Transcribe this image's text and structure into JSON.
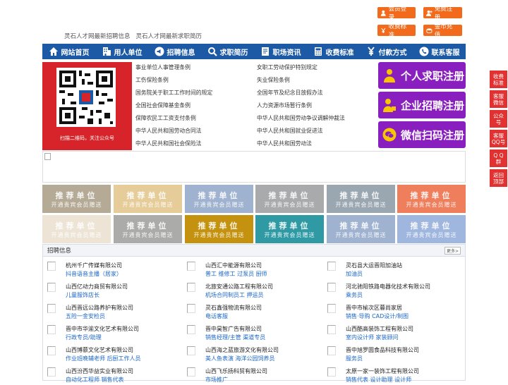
{
  "top_buttons": {
    "login": "会员登录",
    "register": "免费注册",
    "fees": "收费标准",
    "recharge": "金币充值"
  },
  "links": [
    "灵石人才网最新招聘信息",
    "灵石人才网最新求职简历"
  ],
  "nav": [
    {
      "label": "网站首页",
      "icon": "home-icon"
    },
    {
      "label": "用人单位",
      "icon": "building-icon"
    },
    {
      "label": "招聘信息",
      "icon": "megaphone-icon"
    },
    {
      "label": "求职简历",
      "icon": "search-icon"
    },
    {
      "label": "职场资讯",
      "icon": "document-icon"
    },
    {
      "label": "收费标准",
      "icon": "calculator-icon"
    },
    {
      "label": "付款方式",
      "icon": "yen-icon"
    },
    {
      "label": "联系客服",
      "icon": "phone-icon"
    }
  ],
  "qr_caption": "扫描二维码，关注公众号",
  "regulations": [
    [
      "事业单位人事管理条例",
      "女职工劳动保护特别规定"
    ],
    [
      "工伤保险条例",
      "失业保险条例"
    ],
    [
      "国务院关于职工工作时间的规定",
      "全国年节及纪念日放假办法"
    ],
    [
      "全国社会保障基金条例",
      "人力资源市场暂行条例"
    ],
    [
      "保障农民工工资支付条例",
      "中华人民共和国劳动争议调解仲裁法"
    ],
    [
      "中华人民共和国劳动合同法",
      "中华人民共和国就业促进法"
    ],
    [
      "中华人民共和国社会保险法",
      "中华人民共和国劳动法"
    ]
  ],
  "register_buttons": {
    "job_seeker": "个人求职注册",
    "company": "企业招聘注册",
    "wechat": "微信扫码注册"
  },
  "promo": {
    "line1": "推荐单位",
    "line2": "开通贵宾会员赠送",
    "colors": [
      "#b4aa95",
      "#e6cc98",
      "#9fb2cf",
      "#a9aaab",
      "#9aa7b1",
      "#ee7e5c",
      "#ede4d6",
      "#ababaa",
      "#c4920f",
      "#2f9aa4",
      "#9fb2cf",
      "#9fb6de"
    ]
  },
  "jobs": {
    "title": "招聘信息",
    "more": "更多>",
    "items": [
      {
        "company": "杭州千广传媒有限公司",
        "positions": "抖音语音主播（居家）"
      },
      {
        "company": "山西汇中能源有限公司",
        "positions": "普工 维修工 过泵员 厨师"
      },
      {
        "company": "灵石县大运晋阳加油站",
        "positions": "加油员"
      },
      {
        "company": "山西亿动力商贸有限公司",
        "positions": "儿童服饰店长"
      },
      {
        "company": "北旅安通公路工程有限公司",
        "positions": "机场合同制员工 押运员"
      },
      {
        "company": "河北驰阳铁路电器化技术有限公司",
        "positions": "乘务员"
      },
      {
        "company": "山西晋远公路养护有限公司",
        "positions": "五险一金安检员"
      },
      {
        "company": "灵石鑫强物流有限公司",
        "positions": "电话客服"
      },
      {
        "company": "晋中市榆次区暮尚家居",
        "positions": "销售·导购 CAD设计/制图"
      },
      {
        "company": "晋中市华渝文化艺术有限公司",
        "positions": "行政专员/助理"
      },
      {
        "company": "晋中昊智广告有限公司",
        "positions": "销售经理/主管 渠道专员"
      },
      {
        "company": "山西酷高装饰工程有限公司",
        "positions": "室内设计师 家装顾问"
      },
      {
        "company": "山西博慕文化艺术有限公司",
        "positions": "作业班晚辅老师 后厨工作人员"
      },
      {
        "company": "山西海之蓝旅游文化有限公司",
        "positions": "美人鱼表演 海洋公园饲养员"
      },
      {
        "company": "晋中旭罗圆食品科技有限公司",
        "positions": "服务员"
      },
      {
        "company": "山西汾西华益实业有限公司",
        "positions": "自动化工程师 销售代表"
      },
      {
        "company": "山西飞乐扬科贸有限公司",
        "positions": "市场推广"
      },
      {
        "company": "太原一家一装饰工程有限公司",
        "positions": "销售代表 设计助理 设计师"
      }
    ]
  },
  "side_bar": [
    {
      "label": "收费\n标准"
    },
    {
      "label": "客服\n微信"
    },
    {
      "label": "公众\n号"
    },
    {
      "label": "客服\nQQ号"
    },
    {
      "label": "Q Q\n群"
    },
    {
      "label": "返回\n顶部"
    }
  ]
}
